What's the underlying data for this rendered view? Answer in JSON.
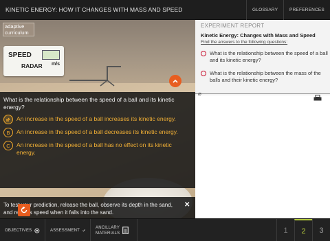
{
  "topbar": {
    "title": "KINETIC ENERGY: HOW IT CHANGES WITH MASS AND SPEED",
    "glossary_label": "GLOSSARY",
    "glossary_icon": "glossary-icon",
    "preferences_label": "PREFERENCES",
    "preferences_icon": "gear-icon"
  },
  "simulation": {
    "logo_line1": "adaptive",
    "logo_line2": "curriculum",
    "radar": {
      "speed_label": "SPEED",
      "radar_label": "RADAR",
      "units": "m/s"
    },
    "question": "What is the relationship between the speed of a ball and its kinetic energy?",
    "answers": [
      {
        "letter": "A",
        "text": "An increase in the speed of a ball increases its kinetic energy."
      },
      {
        "letter": "B",
        "text": "An increase in the speed of a ball decreases its kinetic energy."
      },
      {
        "letter": "C",
        "text": "An increase in the speed of a ball has no effect on its kinetic energy."
      }
    ],
    "instruction": "To test your prediction, release the ball, observe its depth in the sand, and read its speed when it falls into the sand."
  },
  "report": {
    "header": "EXPERIMENT REPORT",
    "title": "Kinetic Energy: Changes with Mass and Speed",
    "subtitle": "Find the answers to the following questions:",
    "questions": [
      "What is the relationship between the speed of a ball and its kinetic energy?",
      "What is the relationship between the mass of the balls and their kinetic energy?"
    ]
  },
  "bottombar": {
    "objectives_label": "OBJECTIVES",
    "assessment_label": "ASSESSMENT",
    "ancillary_label_1": "ANCILLARY",
    "ancillary_label_2": "MATERIALS",
    "pages": [
      "1",
      "2",
      "3"
    ],
    "current_page": "2"
  },
  "colors": {
    "accent_orange": "#e85d1f",
    "answer_gold": "#f2b035",
    "active_page": "#b4c93c",
    "report_dot": "#c8102e"
  }
}
